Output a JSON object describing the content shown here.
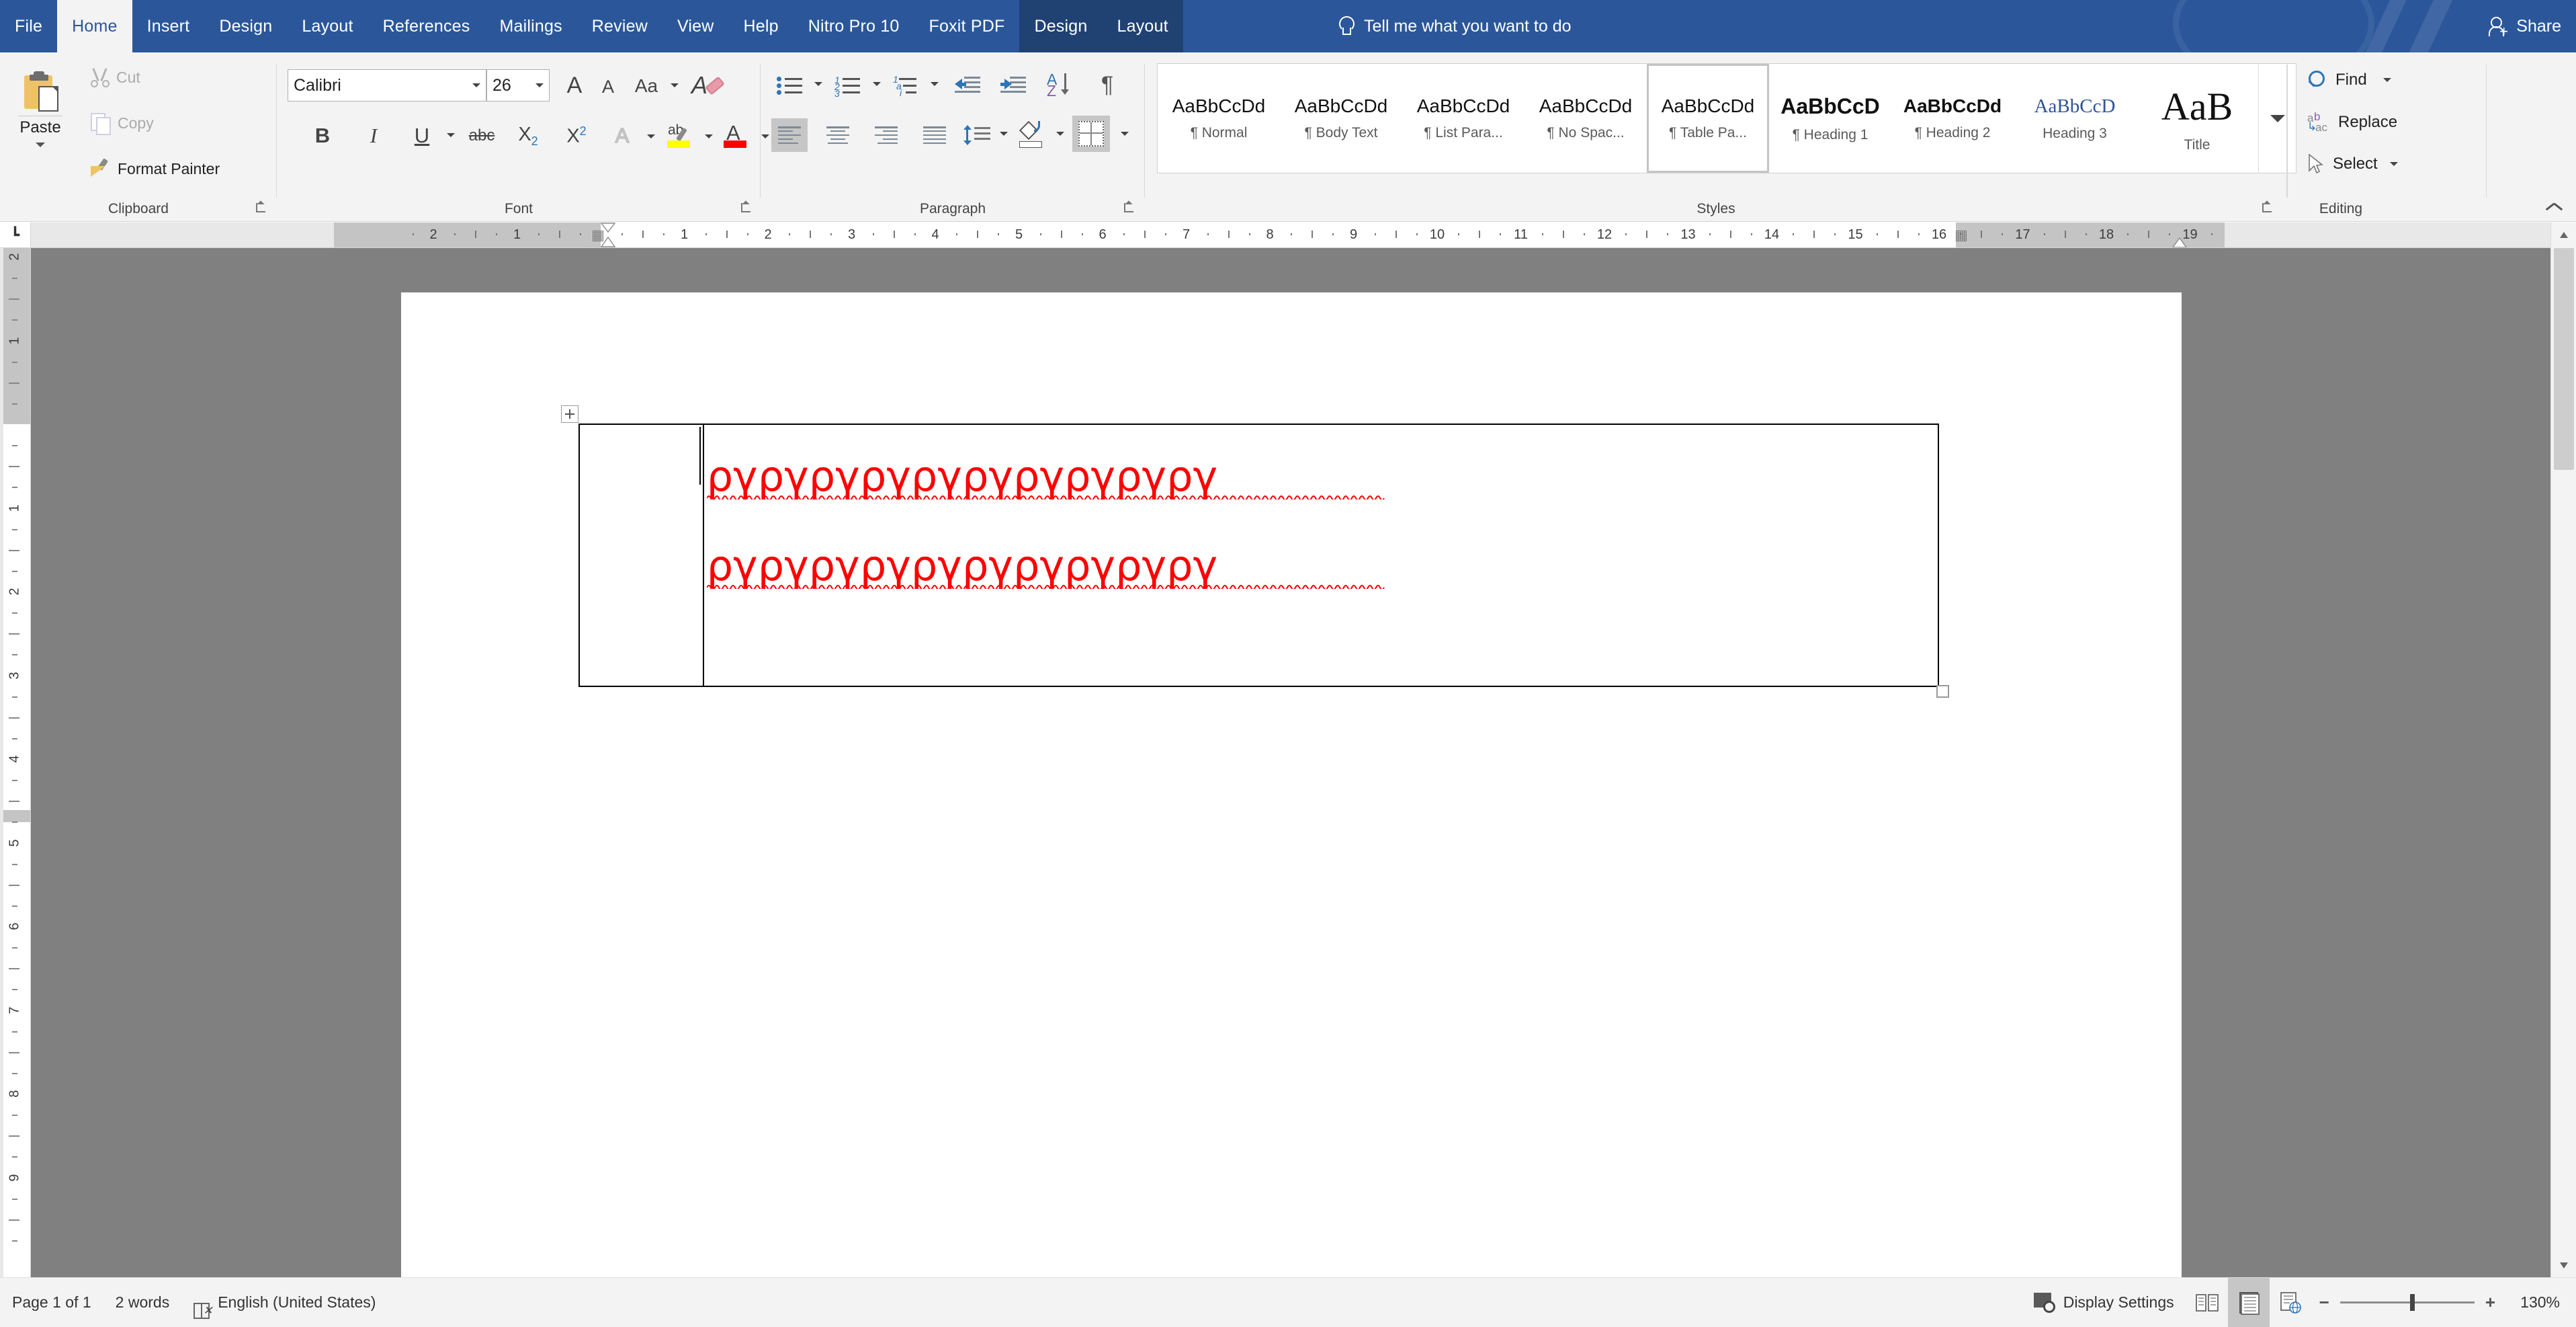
{
  "titlebar": {
    "tabs": [
      {
        "label": "File",
        "state": "normal"
      },
      {
        "label": "Home",
        "state": "active"
      },
      {
        "label": "Insert",
        "state": "normal"
      },
      {
        "label": "Design",
        "state": "normal"
      },
      {
        "label": "Layout",
        "state": "normal"
      },
      {
        "label": "References",
        "state": "normal"
      },
      {
        "label": "Mailings",
        "state": "normal"
      },
      {
        "label": "Review",
        "state": "normal"
      },
      {
        "label": "View",
        "state": "normal"
      },
      {
        "label": "Help",
        "state": "normal"
      },
      {
        "label": "Nitro Pro 10",
        "state": "normal"
      },
      {
        "label": "Foxit PDF",
        "state": "normal"
      },
      {
        "label": "Design",
        "state": "contextual"
      },
      {
        "label": "Layout",
        "state": "contextual"
      }
    ],
    "tell_me": "Tell me what you want to do",
    "share_label": "Share",
    "accent_color": "#2b579a",
    "contextual_color": "#204272"
  },
  "ribbon": {
    "clipboard": {
      "group_label": "Clipboard",
      "paste_label": "Paste",
      "cut_label": "Cut",
      "copy_label": "Copy",
      "format_painter_label": "Format Painter"
    },
    "font": {
      "group_label": "Font",
      "font_family_value": "Calibri",
      "font_size_value": "26",
      "bold_label": "B",
      "italic_label": "I",
      "underline_label": "U",
      "strikethrough_label": "abc",
      "subscript_label": "X",
      "subscript_sub": "2",
      "superscript_label": "X",
      "superscript_sup": "2",
      "change_case_label": "Aa",
      "grow_font_label": "A",
      "shrink_font_label": "A",
      "clear_formatting_label": "A",
      "text_effects_label": "A",
      "highlight_label": "ab",
      "font_color_label": "A",
      "highlight_color": "#ffff00",
      "font_color": "#ff0000"
    },
    "paragraph": {
      "group_label": "Paragraph",
      "bullets": "bullets",
      "numbering": "numbering",
      "multilevel": "multilevel-list",
      "decrease_indent": "decrease-indent",
      "increase_indent": "increase-indent",
      "sort": "sort",
      "show_marks": "¶",
      "align_left": "align-left",
      "align_center": "align-center",
      "align_right": "align-right",
      "justify": "justify",
      "line_spacing": "line-spacing",
      "shading": "shading",
      "borders": "borders",
      "align_left_active": true,
      "borders_active": true
    },
    "styles": {
      "group_label": "Styles",
      "items": [
        {
          "preview": "AaBbCcDd",
          "name": "¶ Normal",
          "sel": false,
          "kind": "normal"
        },
        {
          "preview": "AaBbCcDd",
          "name": "¶ Body Text",
          "sel": false,
          "kind": "normal"
        },
        {
          "preview": "AaBbCcDd",
          "name": "¶ List Para...",
          "sel": false,
          "kind": "normal"
        },
        {
          "preview": "AaBbCcDd",
          "name": "¶ No Spac...",
          "sel": false,
          "kind": "normal"
        },
        {
          "preview": "AaBbCcDd",
          "name": "¶ Table Pa...",
          "sel": true,
          "kind": "normal"
        },
        {
          "preview": "AaBbCcD",
          "name": "¶ Heading 1",
          "sel": false,
          "kind": "h1"
        },
        {
          "preview": "AaBbCcDd",
          "name": "¶ Heading 2",
          "sel": false,
          "kind": "h2"
        },
        {
          "preview": "AaBbCcD",
          "name": "Heading 3",
          "sel": false,
          "kind": "h3"
        },
        {
          "preview": "AaB",
          "name": "Title",
          "sel": false,
          "kind": "title"
        }
      ]
    },
    "editing": {
      "group_label": "Editing",
      "find_label": "Find",
      "replace_label": "Replace",
      "select_label": "Select"
    }
  },
  "rulers": {
    "tab_stop_glyph": "┗",
    "horizontal_numbers": [
      "2",
      "1",
      "1",
      "2",
      "3",
      "4",
      "5",
      "6",
      "7",
      "8",
      "9",
      "10",
      "11",
      "12",
      "13",
      "14",
      "15",
      "16",
      "17",
      "18",
      "19"
    ],
    "vertical_numbers": [
      "2",
      "1",
      "1",
      "2",
      "3",
      "4",
      "5",
      "6",
      "7",
      "8",
      "9"
    ]
  },
  "document": {
    "line1": "ργργργργργργργργργργ",
    "line2": "ργργργργργργργργργργ",
    "text_color": "#ff0000",
    "spellcheck_underline_color": "#ff0000"
  },
  "statusbar": {
    "page_info": "Page 1 of 1",
    "word_count": "2 words",
    "language": "English (United States)",
    "display_settings": "Display Settings",
    "zoom_value": "130%",
    "zoom_minus": "−",
    "zoom_plus": "+",
    "view_read_mode": "read-mode",
    "view_print_layout": "print-layout",
    "view_web_layout": "web-layout",
    "print_layout_active": true
  }
}
